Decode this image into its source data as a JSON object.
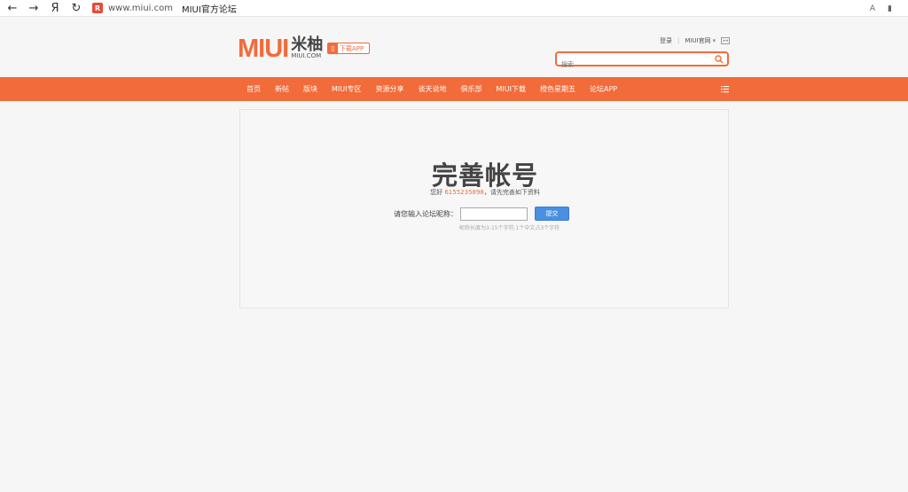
{
  "browser": {
    "back": "←",
    "forward": "→",
    "yandex": "Я",
    "reload": "↻",
    "favicon_letter": "R",
    "url": "www.miui.com",
    "tab_title": "MIUI官方论坛",
    "right_a": "A",
    "right_bookmark": "▮"
  },
  "header": {
    "logo_text": "MIUI",
    "logo_cn": "米柚",
    "logo_en": "MIUI.COM",
    "app_button": "下载APP",
    "login": "登录",
    "separator": "|",
    "official_site": "MIUI官网",
    "dropdown": "▾",
    "search_placeholder": "搜索"
  },
  "nav": {
    "items": [
      "首页",
      "新帖",
      "版块",
      "MIUI专区",
      "资源分享",
      "谈天说地",
      "俱乐部",
      "MIUI下载",
      "橙色星期五",
      "论坛APP"
    ]
  },
  "content": {
    "title": "完善帐号",
    "greeting_prefix": "您好",
    "user_id": "6155235898",
    "greeting_suffix": "，请先完善如下资料",
    "nickname_label": "请您输入论坛昵称：",
    "nickname_value": "",
    "submit_label": "提交",
    "hint": "昵称长度为3-15个字符,1个中文占3个字符"
  },
  "colors": {
    "accent": "#f26b3a",
    "button": "#4a90e2"
  }
}
